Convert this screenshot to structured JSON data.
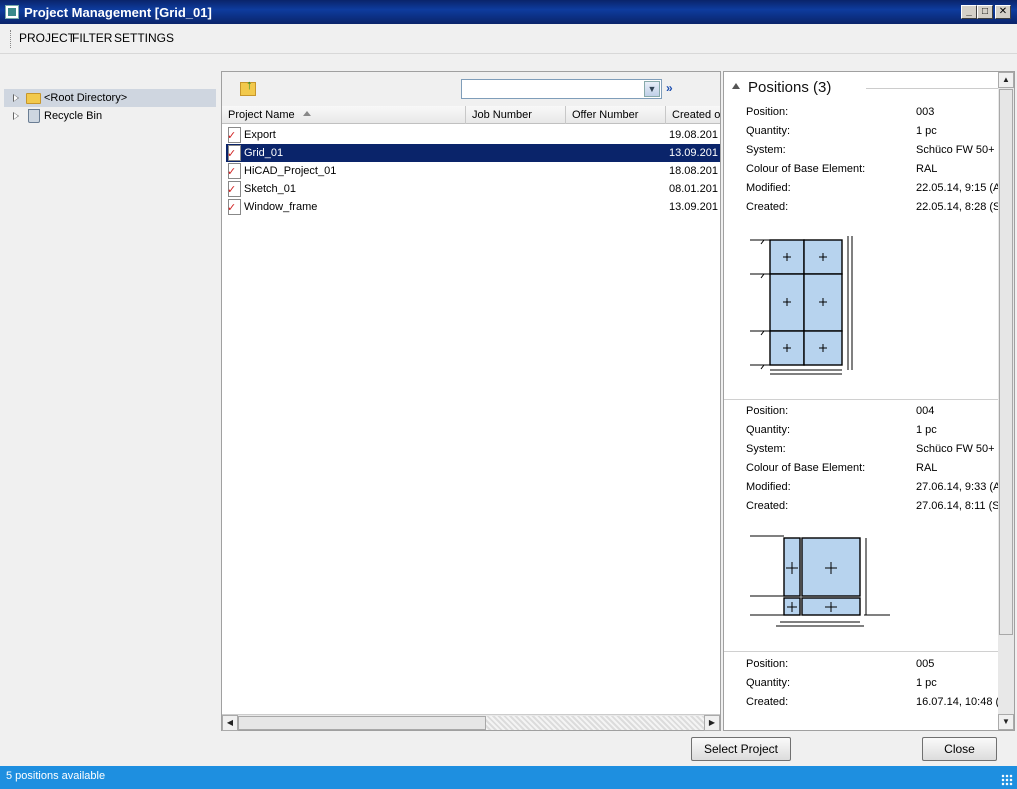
{
  "window": {
    "title": "Project Management [Grid_01]"
  },
  "menu": {
    "project": "PROJECT",
    "filter": "FILTER",
    "settings": "SETTINGS"
  },
  "tree": [
    {
      "label": "<Root Directory>",
      "icon": "folder-icon"
    },
    {
      "label": "Recycle Bin",
      "icon": "recycle-bin-icon"
    }
  ],
  "project_list": {
    "search": {
      "value": ""
    },
    "columns": [
      "Project Name",
      "Job Number",
      "Offer Number",
      "Created o"
    ],
    "rows": [
      {
        "name": "Export",
        "created": "19.08.201"
      },
      {
        "name": "Grid_01",
        "created": "13.09.201"
      },
      {
        "name": "HiCAD_Project_01",
        "created": "18.08.201"
      },
      {
        "name": "Sketch_01",
        "created": "08.01.201"
      },
      {
        "name": "Window_frame",
        "created": "13.09.201"
      }
    ]
  },
  "positions": {
    "title": "Positions (3)",
    "cards": [
      {
        "fields": [
          {
            "key": "Position:",
            "value": "003"
          },
          {
            "key": "Quantity:",
            "value": "1 pc"
          },
          {
            "key": "System:",
            "value": "Schüco FW 50+"
          },
          {
            "key": "Colour of Base Element:",
            "value": "RAL"
          },
          {
            "key": "Modified:",
            "value": "22.05.14,  9:15 (A"
          },
          {
            "key": "Created:",
            "value": "22.05.14,  8:28 (S"
          }
        ]
      },
      {
        "fields": [
          {
            "key": "Position:",
            "value": "004"
          },
          {
            "key": "Quantity:",
            "value": "1 pc"
          },
          {
            "key": "System:",
            "value": "Schüco FW 50+"
          },
          {
            "key": "Colour of Base Element:",
            "value": "RAL"
          },
          {
            "key": "Modified:",
            "value": "27.06.14,  9:33 (A"
          },
          {
            "key": "Created:",
            "value": "27.06.14,  8:11 (S"
          }
        ]
      },
      {
        "fields": [
          {
            "key": "Position:",
            "value": "005"
          },
          {
            "key": "Quantity:",
            "value": "1 pc"
          },
          {
            "key": "Created:",
            "value": "16.07.14, 10:48 ("
          }
        ]
      }
    ]
  },
  "buttons": {
    "select": "Select Project",
    "close": "Close"
  },
  "status": {
    "text": "5 positions available"
  }
}
